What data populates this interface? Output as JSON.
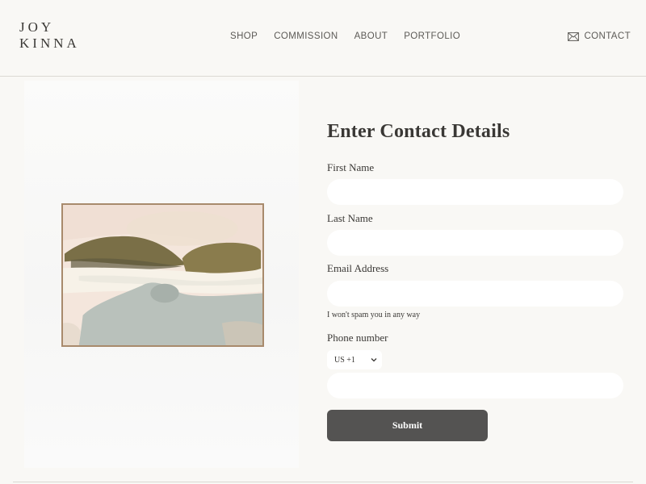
{
  "header": {
    "logo_line1": "JOY",
    "logo_line2": "KINNA",
    "nav": [
      {
        "label": "SHOP"
      },
      {
        "label": "COMMISSION"
      },
      {
        "label": "ABOUT"
      },
      {
        "label": "PORTFOLIO"
      }
    ],
    "contact_label": "CONTACT",
    "contact_icon": "envelope-icon"
  },
  "artwork": {
    "icon": "framed-abstract-painting",
    "colors": {
      "frame": "#a88a6c",
      "canvas": "#f4e6dc",
      "olive": "#7a6f47",
      "sage": "#b9c1bb"
    }
  },
  "form": {
    "title": "Enter Contact Details",
    "first_name": {
      "label": "First Name",
      "value": ""
    },
    "last_name": {
      "label": "Last Name",
      "value": ""
    },
    "email": {
      "label": "Email Address",
      "value": "",
      "hint": "I won't spam you in any way"
    },
    "phone": {
      "label": "Phone number",
      "country_code": "US +1",
      "value": ""
    },
    "submit_label": "Submit"
  },
  "colors": {
    "background": "#f9f8f5",
    "text": "#3a3835",
    "button": "#545352",
    "field": "#ffffff"
  }
}
